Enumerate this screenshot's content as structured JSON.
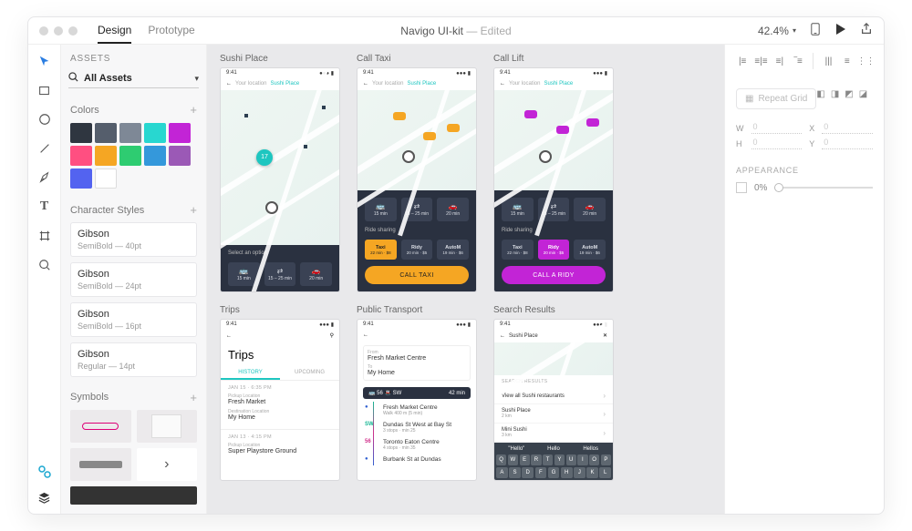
{
  "titlebar": {
    "tabs": {
      "design": "Design",
      "prototype": "Prototype"
    },
    "doc": "Navigo UI-kit",
    "edited": "— Edited",
    "zoom": "42.4%"
  },
  "assets": {
    "header": "ASSETS",
    "search": "All Assets",
    "colors_title": "Colors",
    "swatches": [
      "#2f3640",
      "#555e6c",
      "#7e8896",
      "#28d7d0",
      "#c224d6",
      "#ff4f81",
      "#f5a623",
      "#2ecc71",
      "#3498db",
      "#9b59b6",
      "#5363f0",
      "#ffffff"
    ],
    "styles_title": "Character Styles",
    "styles": [
      {
        "name": "Gibson",
        "detail": "SemiBold — 40pt"
      },
      {
        "name": "Gibson",
        "detail": "SemiBold — 24pt"
      },
      {
        "name": "Gibson",
        "detail": "SemiBold — 16pt"
      },
      {
        "name": "Gibson",
        "detail": "Regular — 14pt"
      }
    ],
    "symbols_title": "Symbols"
  },
  "artboards": {
    "r1": {
      "a": {
        "title": "Sushi Place",
        "time": "9:41",
        "yl": "Your location",
        "sp": "Sushi Place",
        "sel": "Select an option:",
        "pin": "17",
        "opts": [
          {
            "t": "🚌",
            "s": "15 min"
          },
          {
            "t": "⇄",
            "s": "15 – 25 min"
          },
          {
            "t": "🚗",
            "s": "20 min"
          }
        ]
      },
      "b": {
        "title": "Call Taxi",
        "time": "9:41",
        "yl": "Your location",
        "sp": "Sushi Place",
        "rs": "Ride sharing",
        "opts": [
          {
            "t": "🚌",
            "s": "15 min"
          },
          {
            "t": "⇄",
            "s": "15 – 25 min"
          },
          {
            "t": "🚗",
            "s": "20 min"
          }
        ],
        "chips": [
          {
            "t": "Taxi",
            "s": "22 min · $8"
          },
          {
            "t": "Ridy",
            "s": "20 min · $5"
          },
          {
            "t": "AutoM",
            "s": "19 min · $6"
          }
        ],
        "cta": "CALL TAXI"
      },
      "c": {
        "title": "Call Lift",
        "time": "9:41",
        "yl": "Your location",
        "sp": "Sushi Place",
        "rs": "Ride sharing",
        "opts": [
          {
            "t": "🚌",
            "s": "15 min"
          },
          {
            "t": "⇄",
            "s": "15 – 25 min"
          },
          {
            "t": "🚗",
            "s": "20 min"
          }
        ],
        "chips": [
          {
            "t": "Taxi",
            "s": "22 min · $8"
          },
          {
            "t": "Ridy",
            "s": "20 min · $5"
          },
          {
            "t": "AutoM",
            "s": "19 min · $6"
          }
        ],
        "cta": "CALL A RIDY"
      }
    },
    "r2": {
      "a": {
        "title": "Trips",
        "time": "9:41",
        "h": "Trips",
        "tab1": "HISTORY",
        "tab2": "UPCOMING",
        "cards": [
          {
            "date": "JAN 15 · 6:35 PM",
            "l1": "Pickup Location",
            "v1": "Fresh Market",
            "l2": "Destination Location",
            "v2": "My Home"
          },
          {
            "date": "JAN 13 · 4:15 PM",
            "l1": "Pickup Location",
            "v1": "Super Playstore Ground"
          }
        ]
      },
      "b": {
        "title": "Public Transport",
        "time": "9:41",
        "from_l": "From",
        "from_v": "Fresh Market Centre",
        "to_l": "To",
        "to_v": "My Home",
        "darkL": "🚌 56  🚇 SW",
        "darkR": "42 min",
        "steps": [
          {
            "ic": "●",
            "cls": "bl",
            "t": "Fresh Market Centre",
            "s": "Walk 400 m (5 min)"
          },
          {
            "ic": "SW",
            "cls": "gr",
            "t": "Dundas St West at Bay St",
            "s": "3 stops · min 25"
          },
          {
            "ic": "56",
            "cls": "pk",
            "t": "Toronto Eaton Centre",
            "s": "4 stops · min 35"
          },
          {
            "ic": "●",
            "cls": "bl",
            "t": "Burbank St at Dundas",
            "s": ""
          }
        ]
      },
      "c": {
        "title": "Search Results",
        "time": "9:41",
        "q": "Sushi Place",
        "head": "SEARCH RESULTS",
        "rows": [
          {
            "t": "View all Sushi restaurants",
            "s": ""
          },
          {
            "t": "Sushi Place",
            "s": "2 km"
          },
          {
            "t": "Mini Sushi",
            "s": "3 km"
          }
        ],
        "sugg": [
          "\"Hello\"",
          "Hello",
          "Hellos"
        ],
        "kb": [
          "Q",
          "W",
          "E",
          "R",
          "T",
          "Y",
          "U",
          "I",
          "O",
          "P"
        ]
      }
    }
  },
  "inspector": {
    "repeat": "Repeat Grid",
    "w": "W",
    "wval": "0",
    "x": "X",
    "xval": "0",
    "h": "H",
    "hval": "0",
    "y": "Y",
    "yval": "0",
    "app": "APPEARANCE",
    "op": "0%"
  }
}
